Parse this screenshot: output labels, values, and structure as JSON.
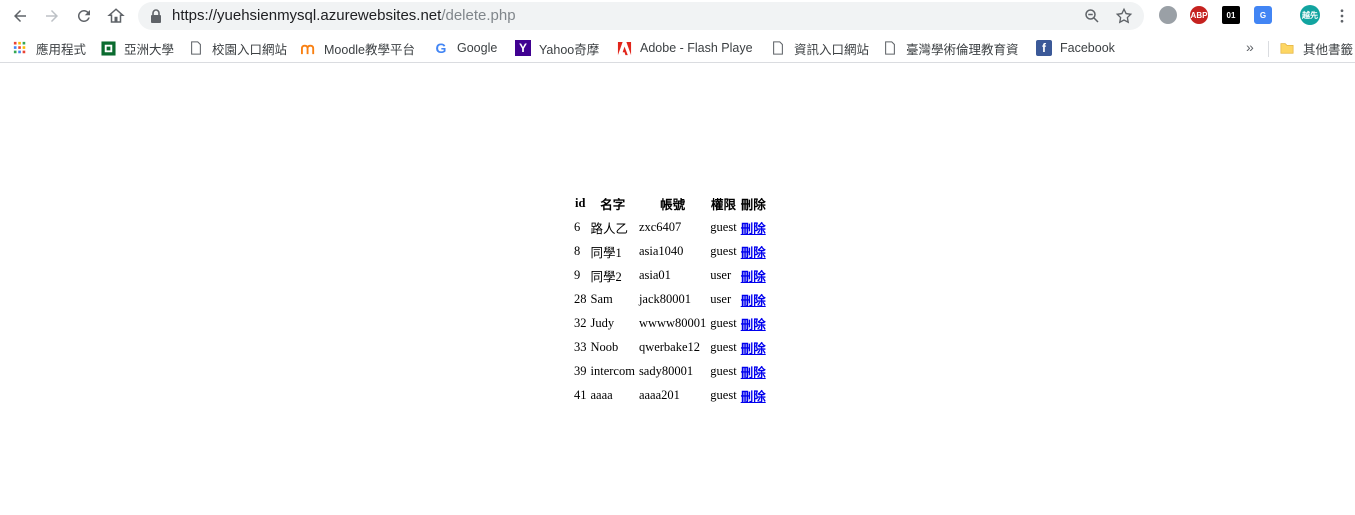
{
  "browser": {
    "url_host": "https://yuehsienmysql.azurewebsites.net",
    "url_path": "/delete.php",
    "profile_label": "越先"
  },
  "bookmarks": {
    "items": [
      {
        "label": "應用程式",
        "icon": "apps-grid-icon"
      },
      {
        "label": "亞洲大學",
        "icon": "asia-university-icon"
      },
      {
        "label": "校園入口網站",
        "icon": "page-icon"
      },
      {
        "label": "Moodle教學平台",
        "icon": "moodle-icon"
      },
      {
        "label": "Google",
        "icon": "google-icon"
      },
      {
        "label": "Yahoo奇摩",
        "icon": "yahoo-icon"
      },
      {
        "label": "Adobe - Flash Playe",
        "icon": "adobe-icon"
      },
      {
        "label": "資訊入口網站",
        "icon": "page-icon"
      },
      {
        "label": "臺灣學術倫理教育資",
        "icon": "page-icon"
      },
      {
        "label": "Facebook",
        "icon": "facebook-icon"
      }
    ],
    "more": "»",
    "other_folder": "其他書籤"
  },
  "table": {
    "headers": [
      "id",
      "名字",
      "帳號",
      "權限",
      "刪除"
    ],
    "rows": [
      {
        "id": "6",
        "name": "路人乙",
        "account": "zxc6407",
        "role": "guest",
        "action": "刪除"
      },
      {
        "id": "8",
        "name": "同學1",
        "account": "asia1040",
        "role": "guest",
        "action": "刪除"
      },
      {
        "id": "9",
        "name": "同學2",
        "account": "asia01",
        "role": "user",
        "action": "刪除"
      },
      {
        "id": "28",
        "name": "Sam",
        "account": "jack80001",
        "role": "user",
        "action": "刪除"
      },
      {
        "id": "32",
        "name": "Judy",
        "account": "wwww80001",
        "role": "guest",
        "action": "刪除"
      },
      {
        "id": "33",
        "name": "Noob",
        "account": "qwerbake12",
        "role": "guest",
        "action": "刪除"
      },
      {
        "id": "39",
        "name": "intercom",
        "account": "sady80001",
        "role": "guest",
        "action": "刪除"
      },
      {
        "id": "41",
        "name": "aaaa",
        "account": "aaaa201",
        "role": "guest",
        "action": "刪除"
      }
    ]
  }
}
